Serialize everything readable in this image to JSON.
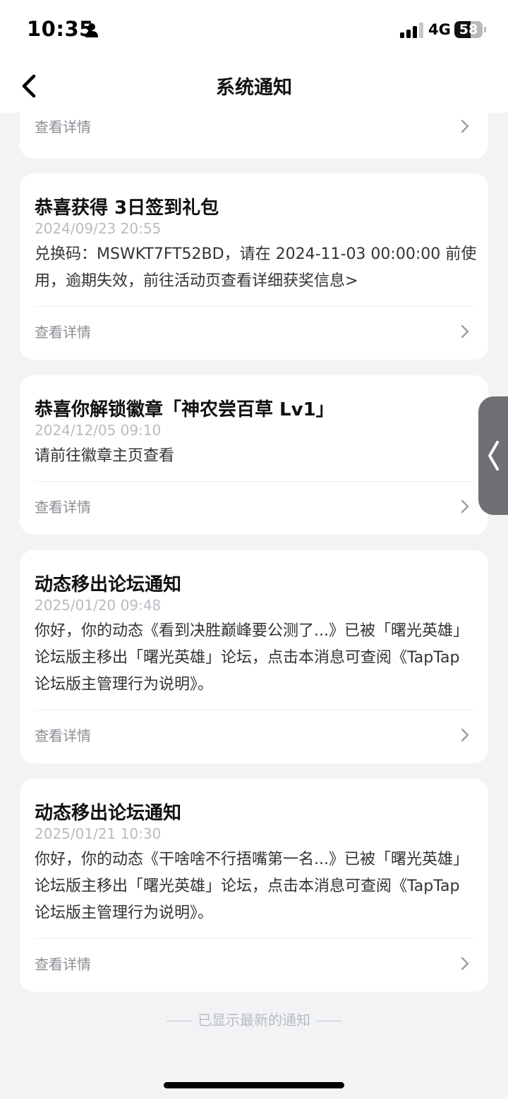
{
  "status_bar": {
    "time": "10:35",
    "network": "4G",
    "battery": "58",
    "battery_level": 0.58,
    "icons": [
      "person-icon",
      "signal-icon",
      "battery-icon"
    ]
  },
  "nav": {
    "back_icon": "chevron-left-icon",
    "title": "系统通知"
  },
  "notifications": [
    {
      "title": "",
      "date": "",
      "body": "",
      "footer_label": "查看详情"
    },
    {
      "title": "恭喜获得 3日签到礼包",
      "date": "2024/09/23 20:55",
      "body": "兑换码：MSWKT7FT52BD，请在 2024-11-03 00:00:00 前使用，逾期失效，前往活动页查看详细获奖信息>",
      "footer_label": "查看详情"
    },
    {
      "title": "恭喜你解锁徽章「神农尝百草 Lv1」",
      "date": "2024/12/05 09:10",
      "body": "请前往徽章主页查看",
      "footer_label": "查看详情"
    },
    {
      "title": "动态移出论坛通知",
      "date": "2025/01/20 09:48",
      "body": "你好，你的动态《看到决胜巅峰要公测了...》已被「曙光英雄」论坛版主移出「曙光英雄」论坛，点击本消息可查阅《TapTap 论坛版主管理行为说明》。",
      "footer_label": "查看详情"
    },
    {
      "title": "动态移出论坛通知",
      "date": "2025/01/21 10:30",
      "body": "你好，你的动态《干啥啥不行捂嘴第一名...》已被「曙光英雄」论坛版主移出「曙光英雄」论坛，点击本消息可查阅《TapTap 论坛版主管理行为说明》。",
      "footer_label": "查看详情"
    }
  ],
  "end_note": "已显示最新的通知",
  "colors": {
    "background": "#f2f3f5",
    "card": "#ffffff",
    "title_text": "#111111",
    "date_text": "#b8bcc2",
    "footer_text": "#8a8e94",
    "side_handle": "#6f7073"
  }
}
